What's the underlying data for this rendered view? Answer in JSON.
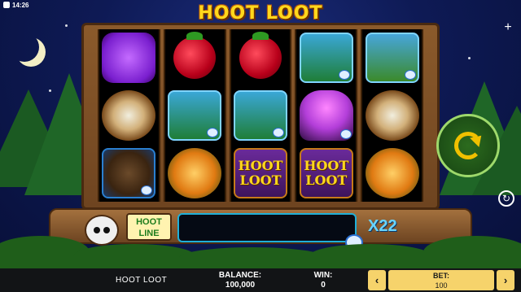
{
  "status": {
    "time": "14:26"
  },
  "game": {
    "logo": "HOOT LOOT",
    "name": "HOOT LOOT"
  },
  "controls": {
    "plus_icon": "+",
    "auto_icon": "↻"
  },
  "reels": [
    [
      {
        "symbol": "paw",
        "label": ""
      },
      {
        "symbol": "nest",
        "label": ""
      },
      {
        "symbol": "porcupine",
        "label": ""
      }
    ],
    [
      {
        "symbol": "raspberry",
        "label": ""
      },
      {
        "symbol": "bear",
        "label": ""
      },
      {
        "symbol": "leaf",
        "label": ""
      }
    ],
    [
      {
        "symbol": "raspberry",
        "label": ""
      },
      {
        "symbol": "bear",
        "label": ""
      },
      {
        "symbol": "wild",
        "label": "HOOT\nLOOT"
      }
    ],
    [
      {
        "symbol": "fox",
        "label": ""
      },
      {
        "symbol": "mushroom",
        "label": ""
      },
      {
        "symbol": "wild",
        "label": "HOOT\nLOOT"
      }
    ],
    [
      {
        "symbol": "moose",
        "label": ""
      },
      {
        "symbol": "nest",
        "label": ""
      },
      {
        "symbol": "leaf",
        "label": ""
      }
    ]
  ],
  "hoot_line": {
    "label_line1": "HOOT",
    "label_line2": "LINE",
    "multiplier": "X22"
  },
  "footer": {
    "balance_label": "BALANCE:",
    "balance_value": "100,000",
    "win_label": "WIN:",
    "win_value": "0",
    "bet_label": "BET:",
    "bet_value": "100",
    "bet_decrease": "‹",
    "bet_increase": "›"
  },
  "colors": {
    "logo_yellow": "#ffd81c",
    "multiplier_blue": "#69d5ff",
    "bet_panel": "#f6d36b"
  }
}
